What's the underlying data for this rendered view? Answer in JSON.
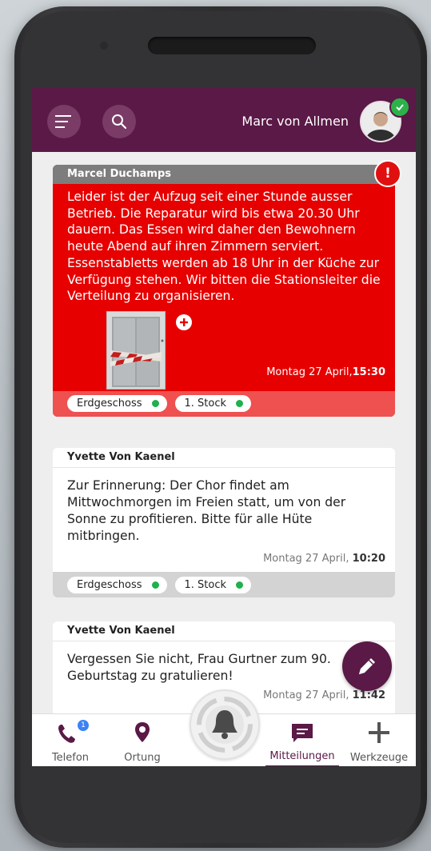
{
  "header": {
    "user_name": "Marc von Allmen",
    "colors": {
      "bar": "#5a1946",
      "online": "#2bb34a"
    }
  },
  "messages": [
    {
      "author": "Marcel Duchamps",
      "urgent": true,
      "text": "Leider ist der Aufzug seit einer Stunde ausser Betrieb. Die Reparatur wird bis etwa 20.30 Uhr dauern. Das Essen wird daher den Bewohnern heute Abend auf ihren Zimmern serviert. Essenstabletts werden ab 18 Uhr in der Küche zur Verfügung stehen. Wir bitten die Stationsleiter die Verteilung zu organisieren.",
      "date": "Montag 27 April,",
      "time": "15:30",
      "tags": [
        "Erdgeschoss",
        "1. Stock"
      ],
      "alert_symbol": "!"
    },
    {
      "author": "Yvette Von Kaenel",
      "urgent": false,
      "text": "Zur Erinnerung: Der Chor findet am Mittwochmorgen im Freien statt, um von der Sonne zu profitieren. Bitte für alle Hüte mitbringen.",
      "date": "Montag 27 April,",
      "time": "10:20",
      "tags": [
        "Erdgeschoss",
        "1. Stock"
      ]
    },
    {
      "author": "Yvette Von Kaenel",
      "urgent": false,
      "text": "Vergessen Sie nicht, Frau Gurtner zum 90. Geburtstag zu gratulieren!",
      "date": "Montag 27 April,",
      "time": "11:42"
    }
  ],
  "nav": {
    "telefon": "Telefon",
    "telefon_badge": "1",
    "ortung": "Ortung",
    "mitteilungen": "Mitteilungen",
    "werkzeuge": "Werkzeuge"
  },
  "colors": {
    "urgent_bg": "#e60000",
    "urgent_foot": "#ef5050",
    "accent": "#5a1946",
    "dot": "#1fb14c"
  }
}
